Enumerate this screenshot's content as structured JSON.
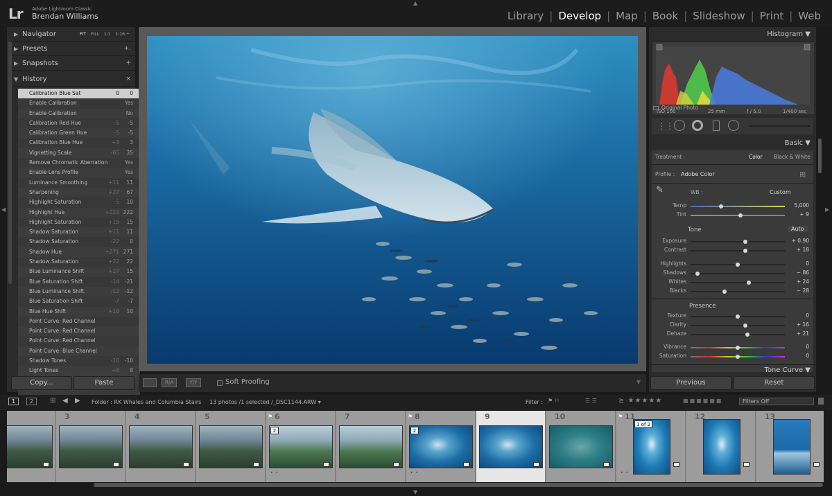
{
  "app": {
    "logo": "Lr",
    "name": "Adobe Lightroom Classic",
    "user": "Brendan Williams"
  },
  "modules": [
    {
      "label": "Library",
      "active": false
    },
    {
      "label": "Develop",
      "active": true
    },
    {
      "label": "Map",
      "active": false
    },
    {
      "label": "Book",
      "active": false
    },
    {
      "label": "Slideshow",
      "active": false
    },
    {
      "label": "Print",
      "active": false
    },
    {
      "label": "Web",
      "active": false
    }
  ],
  "left_panel": {
    "navigator": {
      "label": "Navigator",
      "zoom": [
        "FIT",
        "FILL",
        "1:1",
        "1:16 ÷"
      ]
    },
    "presets": {
      "label": "Presets",
      "action": "+."
    },
    "snapshots": {
      "label": "Snapshots",
      "action": "+"
    },
    "history": {
      "label": "History",
      "action": "×",
      "rows": [
        {
          "name": "Calibration Blue Sat",
          "before": "0",
          "after": "0",
          "selected": true
        },
        {
          "name": "Enable Calibration",
          "before": "",
          "after": "Yes"
        },
        {
          "name": "Enable Calibration",
          "before": "",
          "after": "No"
        },
        {
          "name": "Calibration Red Hue",
          "before": "-5",
          "after": "-5"
        },
        {
          "name": "Calibration Green Hue",
          "before": "-5",
          "after": "-5"
        },
        {
          "name": "Calibration Blue Hue",
          "before": "+3",
          "after": "3"
        },
        {
          "name": "Vignetting Scale",
          "before": "-65",
          "after": "35"
        },
        {
          "name": "Remove Chromatic Aberration",
          "before": "",
          "after": "Yes"
        },
        {
          "name": "Enable Lens Profile",
          "before": "",
          "after": "Yes"
        },
        {
          "name": "Luminance Smoothing",
          "before": "+11",
          "after": "11"
        },
        {
          "name": "Sharpening",
          "before": "+27",
          "after": "67"
        },
        {
          "name": "Highlight Saturation",
          "before": "-5",
          "after": "10"
        },
        {
          "name": "Highlight Hue",
          "before": "+222",
          "after": "222"
        },
        {
          "name": "Highlight Saturation",
          "before": "+15",
          "after": "15"
        },
        {
          "name": "Shadow Saturation",
          "before": "+11",
          "after": "11"
        },
        {
          "name": "Shadow Saturation",
          "before": "-22",
          "after": "0"
        },
        {
          "name": "Shadow Hue",
          "before": "+271",
          "after": "271"
        },
        {
          "name": "Shadow Saturation",
          "before": "+22",
          "after": "22"
        },
        {
          "name": "Blue Luminance Shift",
          "before": "+27",
          "after": "15"
        },
        {
          "name": "Blue Saturation Shift",
          "before": "-14",
          "after": "-21"
        },
        {
          "name": "Blue Luminance Shift",
          "before": "-12",
          "after": "-12"
        },
        {
          "name": "Blue Saturation Shift",
          "before": "-7",
          "after": "-7"
        },
        {
          "name": "Blue Hue Shift",
          "before": "+10",
          "after": "10"
        },
        {
          "name": "Point Curve: Red Channel",
          "before": "",
          "after": ""
        },
        {
          "name": "Point Curve: Red Channel",
          "before": "",
          "after": ""
        },
        {
          "name": "Point Curve: Red Channel",
          "before": "",
          "after": ""
        },
        {
          "name": "Point Curve: Blue Channel",
          "before": "",
          "after": ""
        },
        {
          "name": "Shadow Tones",
          "before": "-10",
          "after": "-10"
        },
        {
          "name": "Light Tones",
          "before": "+8",
          "after": "8"
        }
      ]
    },
    "copy_label": "Copy...",
    "paste_label": "Paste"
  },
  "toolbar": {
    "soft_proofing": "Soft Proofing",
    "ra": "R|A",
    "yy": "Y|Y"
  },
  "right_panel": {
    "histogram_label": "Histogram",
    "exif": {
      "iso": "ISO 100",
      "focal": "25 mm",
      "aperture": "f / 5.0",
      "shutter": "1/400 sec"
    },
    "original_photo": "Original Photo",
    "basic_label": "Basic",
    "treatment_label": "Treatment :",
    "treatment_color": "Color",
    "treatment_bw": "Black & White",
    "profile_label": "Profile :",
    "profile_value": "Adobe Color",
    "wb_label": "WB :",
    "wb_value": "Custom",
    "tone_label": "Tone",
    "auto_label": "Auto",
    "presence_label": "Presence",
    "sliders": [
      {
        "label": "Temp",
        "value": "5,000",
        "pos": 0.32
      },
      {
        "label": "Tint",
        "value": "+ 9",
        "pos": 0.53
      },
      {
        "label": "Exposure",
        "value": "+ 0.90",
        "pos": 0.58
      },
      {
        "label": "Contrast",
        "value": "+ 18",
        "pos": 0.58
      },
      {
        "label": "Highlights",
        "value": "0",
        "pos": 0.5
      },
      {
        "label": "Shadows",
        "value": "− 86",
        "pos": 0.07
      },
      {
        "label": "Whites",
        "value": "+ 24",
        "pos": 0.62
      },
      {
        "label": "Blacks",
        "value": "− 28",
        "pos": 0.36
      },
      {
        "label": "Texture",
        "value": "0",
        "pos": 0.5
      },
      {
        "label": "Clarity",
        "value": "+ 16",
        "pos": 0.58
      },
      {
        "label": "Dehaze",
        "value": "+ 21",
        "pos": 0.6
      },
      {
        "label": "Vibrance",
        "value": "0",
        "pos": 0.5
      },
      {
        "label": "Saturation",
        "value": "0",
        "pos": 0.5
      }
    ],
    "tone_curve_label": "Tone Curve",
    "previous_label": "Previous",
    "reset_label": "Reset"
  },
  "filmstrip_bar": {
    "page1": "1",
    "page2": "2",
    "folder": "Folder : RK Whales and Columbia Stairs",
    "count": "13 photos /1 selected /_DSC1144.ARW ▾",
    "filter_label": "Filter :",
    "filters_off": "Filters Off"
  },
  "filmstrip": [
    {
      "num": "",
      "kind": "land",
      "badge": ""
    },
    {
      "num": "3",
      "kind": "land",
      "badge": ""
    },
    {
      "num": "4",
      "kind": "land",
      "badge": ""
    },
    {
      "num": "5",
      "kind": "land",
      "badge": ""
    },
    {
      "num": "6",
      "kind": "island",
      "badge": "2",
      "dots": "• •"
    },
    {
      "num": "7",
      "kind": "island",
      "badge": ""
    },
    {
      "num": "8",
      "kind": "whale",
      "badge": "2",
      "dots": "• •"
    },
    {
      "num": "9",
      "kind": "whale",
      "badge": "",
      "selected": true
    },
    {
      "num": "10",
      "kind": "whale-teal",
      "badge": ""
    },
    {
      "num": "11",
      "kind": "whale-portrait",
      "badge": "1 of 2",
      "dots": "• •"
    },
    {
      "num": "12",
      "kind": "whale-portrait",
      "badge": ""
    },
    {
      "num": "13",
      "kind": "boat-portrait",
      "badge": ""
    }
  ]
}
